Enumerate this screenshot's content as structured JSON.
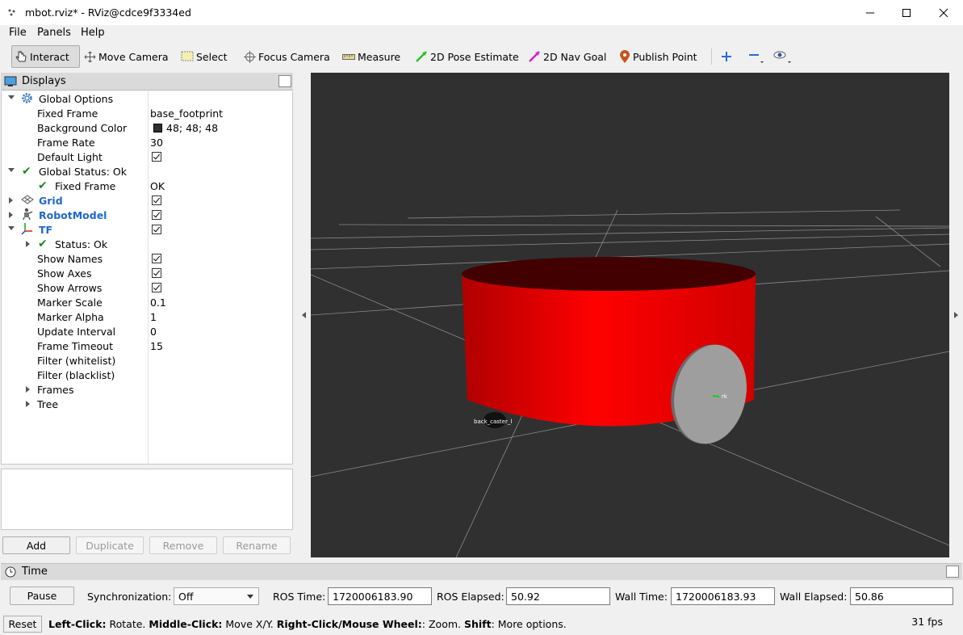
{
  "window": {
    "title": "mbot.rviz* - RViz@cdce9f3334ed"
  },
  "menu": {
    "file": "File",
    "panels": "Panels",
    "help": "Help"
  },
  "toolbar": {
    "interact": "Interact",
    "move_camera": "Move Camera",
    "select": "Select",
    "focus_camera": "Focus Camera",
    "measure": "Measure",
    "pose_estimate": "2D Pose Estimate",
    "nav_goal": "2D Nav Goal",
    "publish_point": "Publish Point"
  },
  "displays": {
    "title": "Displays",
    "global_options": {
      "label": "Global Options",
      "fixed_frame_label": "Fixed Frame",
      "fixed_frame_value": "base_footprint",
      "background_color_label": "Background Color",
      "background_color_value": "48; 48; 48",
      "frame_rate_label": "Frame Rate",
      "frame_rate_value": "30",
      "default_light_label": "Default Light"
    },
    "global_status": {
      "label": "Global Status: Ok",
      "fixed_frame_label": "Fixed Frame",
      "fixed_frame_value": "OK"
    },
    "grid": "Grid",
    "robot_model": "RobotModel",
    "tf": {
      "label": "TF",
      "status": "Status: Ok",
      "show_names": "Show Names",
      "show_axes": "Show Axes",
      "show_arrows": "Show Arrows",
      "marker_scale_label": "Marker Scale",
      "marker_scale_value": "0.1",
      "marker_alpha_label": "Marker Alpha",
      "marker_alpha_value": "1",
      "update_interval_label": "Update Interval",
      "update_interval_value": "0",
      "frame_timeout_label": "Frame Timeout",
      "frame_timeout_value": "15",
      "filter_whitelist": "Filter (whitelist)",
      "filter_blacklist": "Filter (blacklist)",
      "frames": "Frames",
      "tree": "Tree"
    },
    "buttons": {
      "add": "Add",
      "duplicate": "Duplicate",
      "remove": "Remove",
      "rename": "Rename"
    }
  },
  "view3d": {
    "background": "#303030",
    "robot_color": "#ff0000",
    "wheel_color": "#9a9a9a",
    "labels": {
      "caster": "back_caster_l",
      "wheel": "rk"
    }
  },
  "time": {
    "title": "Time",
    "pause": "Pause",
    "sync_label": "Synchronization:",
    "sync_value": "Off",
    "ros_time_label": "ROS Time:",
    "ros_time_value": "1720006183.90",
    "ros_elapsed_label": "ROS Elapsed:",
    "ros_elapsed_value": "50.92",
    "wall_time_label": "Wall Time:",
    "wall_time_value": "1720006183.93",
    "wall_elapsed_label": "Wall Elapsed:",
    "wall_elapsed_value": "50.86"
  },
  "status": {
    "reset": "Reset",
    "hint_b1": "Left-Click:",
    "hint_t1": " Rotate. ",
    "hint_b2": "Middle-Click:",
    "hint_t2": " Move X/Y. ",
    "hint_b3": "Right-Click/Mouse Wheel:",
    "hint_t3": ": Zoom. ",
    "hint_b4": "Shift",
    "hint_t4": ": More options.",
    "fps": "31 fps"
  }
}
